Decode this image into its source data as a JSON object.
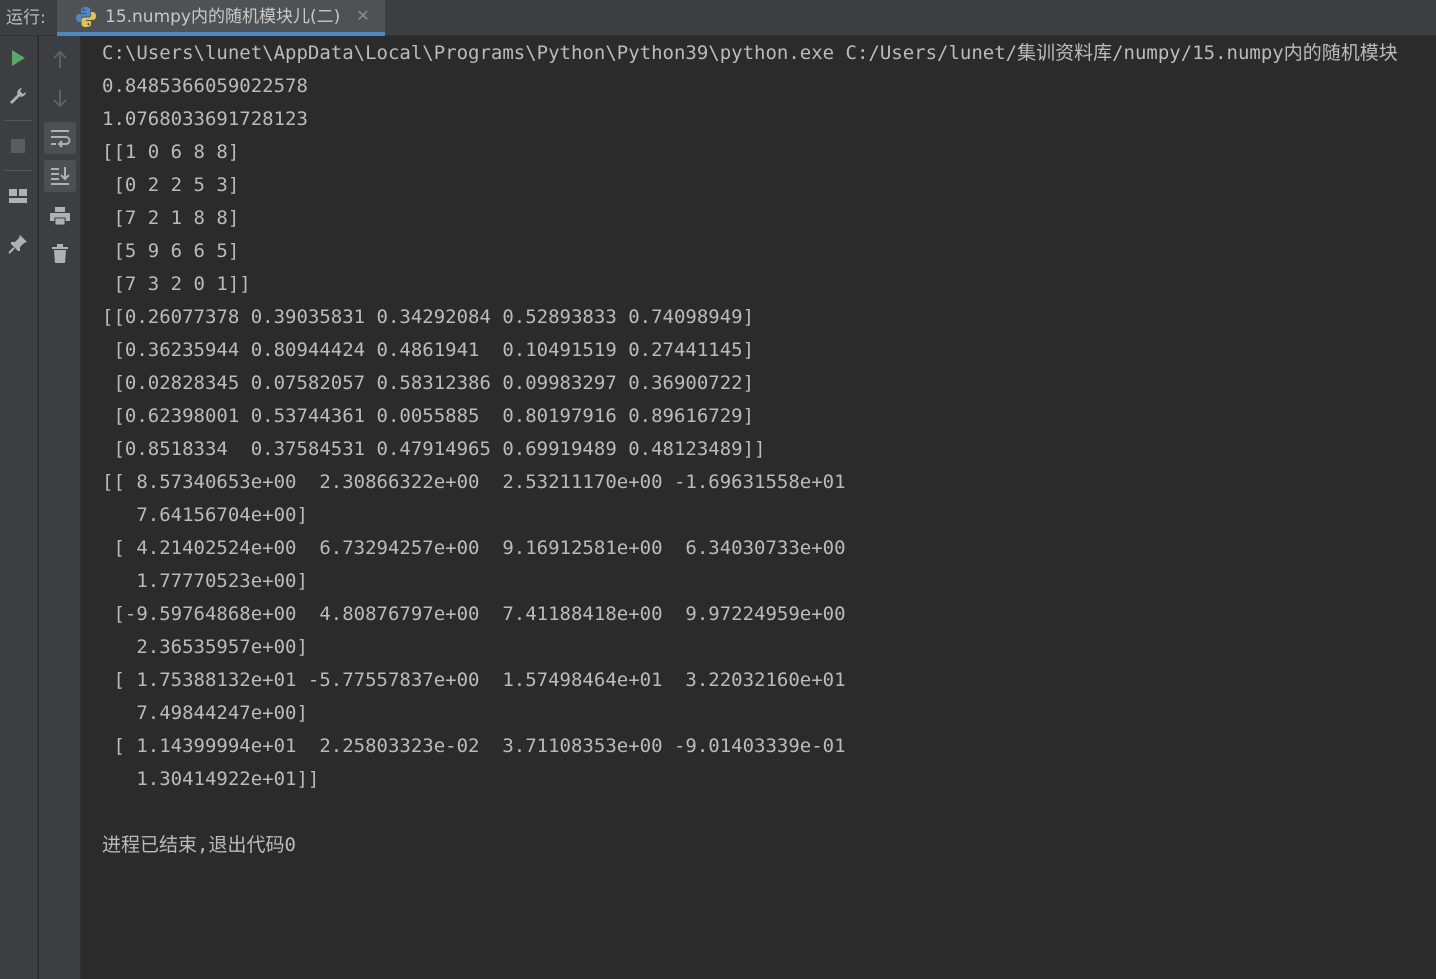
{
  "tabbar": {
    "run_label": "运行:",
    "tab_title": "15.numpy内的随机模块儿(二)",
    "tab_icon": "python-icon",
    "close_icon": "close-icon"
  },
  "toolbar": {
    "left": [
      "rerun-icon",
      "wrench-icon",
      "stop-icon",
      "layout-icon",
      "pin-icon"
    ],
    "right": [
      "up-arrow-icon",
      "down-arrow-icon",
      "soft-wrap-icon",
      "scroll-to-end-icon",
      "print-icon",
      "trash-icon"
    ]
  },
  "console": {
    "lines": [
      "C:\\Users\\lunet\\AppData\\Local\\Programs\\Python\\Python39\\python.exe C:/Users/lunet/集训资料库/numpy/15.numpy内的随机模块",
      "0.8485366059022578",
      "1.0768033691728123",
      "[[1 0 6 8 8]",
      " [0 2 2 5 3]",
      " [7 2 1 8 8]",
      " [5 9 6 6 5]",
      " [7 3 2 0 1]]",
      "[[0.26077378 0.39035831 0.34292084 0.52893833 0.74098949]",
      " [0.36235944 0.80944424 0.4861941  0.10491519 0.27441145]",
      " [0.02828345 0.07582057 0.58312386 0.09983297 0.36900722]",
      " [0.62398001 0.53744361 0.0055885  0.80197916 0.89616729]",
      " [0.8518334  0.37584531 0.47914965 0.69919489 0.48123489]]",
      "[[ 8.57340653e+00  2.30866322e+00  2.53211170e+00 -1.69631558e+01",
      "   7.64156704e+00]",
      " [ 4.21402524e+00  6.73294257e+00  9.16912581e+00  6.34030733e+00",
      "   1.77770523e+00]",
      " [-9.59764868e+00  4.80876797e+00  7.41188418e+00  9.97224959e+00",
      "   2.36535957e+00]",
      " [ 1.75388132e+01 -5.77557837e+00  1.57498464e+01  3.22032160e+01",
      "   7.49844247e+00]",
      " [ 1.14399994e+01  2.25803323e-02  3.71108353e+00 -9.01403339e-01",
      "   1.30414922e+01]]",
      "",
      "进程已结束,退出代码0"
    ]
  }
}
